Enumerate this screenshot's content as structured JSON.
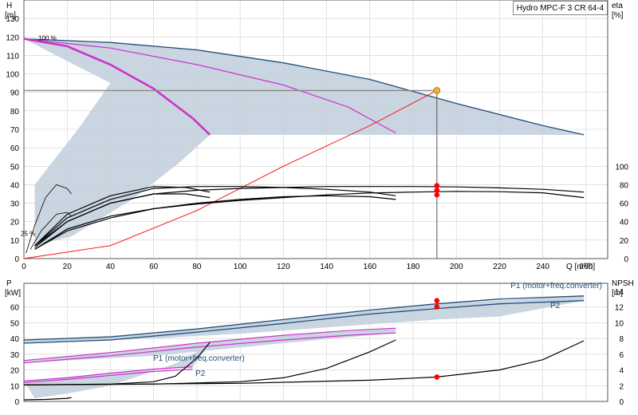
{
  "title": "Hydro MPC-F 3 CR 64-4",
  "colors": {
    "band": "#c9d5e1",
    "navy": "#1f4e79",
    "magenta": "#cc33cc",
    "red": "#ff0000",
    "dot": "#f0b030",
    "grid": "#cfcfcf",
    "gray": "#888888"
  },
  "chart_data": [
    {
      "type": "line",
      "name": "pump-curves",
      "xlabel": "Q [m³/h]",
      "ylabel": "H [m]",
      "y2label": "eta [%]",
      "xlim": [
        0,
        270
      ],
      "ylim": [
        0,
        140
      ],
      "y2lim": [
        0,
        140
      ],
      "x_ticks": [
        0,
        20,
        40,
        60,
        80,
        100,
        120,
        140,
        160,
        180,
        200,
        220,
        240,
        260
      ],
      "y_ticks": [
        0,
        10,
        20,
        30,
        40,
        50,
        60,
        70,
        80,
        90,
        100,
        110,
        120,
        130
      ],
      "y2_ticks": [
        0,
        20,
        40,
        60,
        80,
        100
      ],
      "grid": true,
      "labels": [
        "100 %",
        "25 %"
      ],
      "series": [
        {
          "style": "navy",
          "x": [
            0,
            40,
            80,
            120,
            160,
            200,
            240,
            259
          ],
          "y": [
            119,
            117,
            113,
            106,
            97,
            84,
            72,
            67
          ]
        },
        {
          "style": "magenta",
          "x": [
            0,
            40,
            80,
            120,
            150,
            172
          ],
          "y": [
            119,
            114,
            105,
            94,
            82,
            68
          ]
        },
        {
          "style": "magenta-thick",
          "x": [
            0,
            20,
            40,
            60,
            78,
            86
          ],
          "y": [
            119,
            115,
            105,
            92,
            76,
            67
          ]
        },
        {
          "style": "system-red",
          "x": [
            0,
            40,
            80,
            120,
            160,
            191
          ],
          "y": [
            0,
            7,
            26,
            50,
            72,
            91
          ]
        },
        {
          "style": "eta-black",
          "x": [
            5,
            20,
            40,
            60,
            80,
            100,
            120,
            140,
            160,
            180,
            200,
            220,
            240,
            259
          ],
          "y": [
            7,
            20,
            30,
            35,
            37,
            38,
            38.5,
            39,
            39,
            39,
            38.8,
            38.3,
            37.5,
            36
          ]
        },
        {
          "style": "eta-black",
          "x": [
            5,
            20,
            40,
            60,
            80,
            100,
            120,
            140,
            160,
            180,
            200,
            220,
            240,
            259
          ],
          "y": [
            5,
            16,
            23,
            27,
            29.5,
            31.5,
            33,
            34.5,
            35.5,
            36,
            36.4,
            36.2,
            35.6,
            33
          ]
        },
        {
          "style": "eta-black",
          "x": [
            5,
            20,
            40,
            60,
            80,
            100,
            120,
            140,
            160,
            172
          ],
          "y": [
            7,
            22,
            32,
            38,
            39,
            39,
            38.5,
            37.5,
            36,
            34
          ]
        },
        {
          "style": "eta-black",
          "x": [
            5,
            20,
            40,
            60,
            80,
            100,
            120,
            140,
            160,
            172
          ],
          "y": [
            5,
            15,
            22,
            27,
            30,
            32,
            33.5,
            34,
            33.5,
            32
          ]
        },
        {
          "style": "eta-black",
          "x": [
            5,
            20,
            40,
            60,
            75,
            86
          ],
          "y": [
            7,
            24,
            34,
            39,
            38.5,
            36
          ]
        },
        {
          "style": "eta-black",
          "x": [
            5,
            20,
            40,
            60,
            75,
            86
          ],
          "y": [
            6,
            20,
            30,
            35,
            35,
            33
          ]
        },
        {
          "style": "eta-black-thin",
          "x": [
            1,
            5,
            10,
            15,
            20,
            22
          ],
          "y": [
            3,
            18,
            33,
            40,
            38,
            35
          ]
        },
        {
          "style": "eta-black-thin",
          "x": [
            3,
            8,
            15,
            20,
            22
          ],
          "y": [
            5,
            15,
            24,
            25,
            23
          ]
        }
      ],
      "operating_point": {
        "x": 191,
        "y": 91,
        "eta": [
          79,
          74,
          69
        ]
      }
    },
    {
      "type": "line",
      "name": "power-npsh",
      "xlabel": "",
      "ylabel": "P [kW]",
      "y2label": "NPSH [m]",
      "xlim": [
        0,
        270
      ],
      "ylim": [
        0,
        75
      ],
      "y2lim": [
        0,
        15
      ],
      "y_ticks": [
        0,
        10,
        20,
        30,
        40,
        50,
        60
      ],
      "y2_ticks": [
        0,
        2,
        4,
        6,
        8,
        10,
        12,
        14
      ],
      "grid": true,
      "labels": [
        "P1 (motor+freq.converter)",
        "P2",
        "P1 (motor+freq.converter)",
        "P2"
      ],
      "series": [
        {
          "style": "navy",
          "x": [
            0,
            40,
            80,
            120,
            160,
            191,
            220,
            259
          ],
          "y": [
            39,
            41,
            46,
            52,
            58,
            62,
            65,
            67
          ]
        },
        {
          "style": "navy",
          "x": [
            0,
            40,
            80,
            120,
            160,
            191,
            220,
            259
          ],
          "y": [
            37,
            39,
            44,
            49.5,
            55.5,
            59,
            62,
            64
          ]
        },
        {
          "style": "magenta",
          "x": [
            0,
            40,
            80,
            120,
            150,
            172
          ],
          "y": [
            26,
            31,
            37,
            42,
            45,
            46.5
          ]
        },
        {
          "style": "magenta",
          "x": [
            0,
            40,
            80,
            120,
            150,
            172
          ],
          "y": [
            24.5,
            29,
            34.5,
            39,
            42,
            43.5
          ]
        },
        {
          "style": "magenta",
          "x": [
            0,
            20,
            40,
            60,
            78
          ],
          "y": [
            13,
            15,
            18,
            20.5,
            22
          ]
        },
        {
          "style": "magenta",
          "x": [
            0,
            20,
            40,
            60,
            78
          ],
          "y": [
            12,
            14,
            16.5,
            19,
            20.5
          ]
        },
        {
          "style": "npsh-black",
          "x": [
            0,
            40,
            60,
            70,
            80,
            86
          ],
          "y": [
            2.1,
            2.2,
            2.5,
            3.2,
            5.5,
            7.5
          ]
        },
        {
          "style": "npsh-black",
          "x": [
            0,
            60,
            100,
            120,
            140,
            160,
            172
          ],
          "y": [
            2.1,
            2.2,
            2.5,
            3.0,
            4.2,
            6.3,
            7.8
          ]
        },
        {
          "style": "npsh-black",
          "x": [
            0,
            100,
            160,
            191,
            220,
            240,
            259
          ],
          "y": [
            2.1,
            2.3,
            2.7,
            3.1,
            4.0,
            5.3,
            7.7
          ]
        },
        {
          "style": "npsh-black",
          "x": [
            0,
            10,
            20,
            22
          ],
          "y": [
            0.2,
            0.25,
            0.4,
            0.5
          ]
        }
      ],
      "operating_point": {
        "x": 191,
        "p": [
          64,
          60
        ],
        "npsh": 3.1
      }
    }
  ]
}
